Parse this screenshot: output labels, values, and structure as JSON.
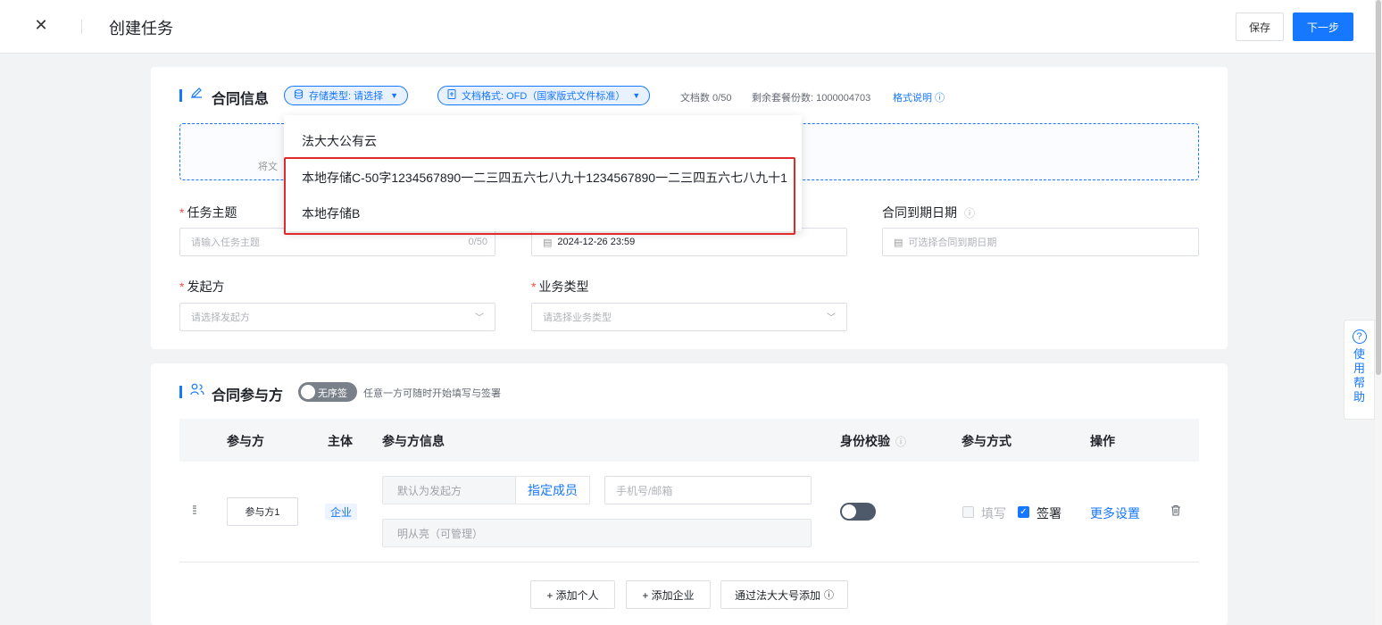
{
  "header": {
    "close": "✕",
    "title": "创建任务",
    "save_label": "保存",
    "next_label": "下一步"
  },
  "contract_info": {
    "title": "合同信息",
    "storage_type_label": "存储类型: 请选择",
    "doc_format_label": "文档格式: OFD（国家版式文件标准）",
    "doc_count": "文档数 0/50",
    "remaining": "剩余套餐份数: 1000004703",
    "format_help": "格式说明",
    "upload_hint": "将文",
    "storage_options": [
      "法大大公有云",
      "本地存储C-50字1234567890一二三四五六七八九十1234567890一二三四五六七八九十1",
      "本地存储B"
    ],
    "task_subject": {
      "label": "任务主题",
      "placeholder": "请输入任务主题",
      "counter": "0/50"
    },
    "deadline": {
      "value": "2024-12-26 23:59"
    },
    "expiry": {
      "label": "合同到期日期",
      "placeholder": "可选择合同到期日期"
    },
    "initiator": {
      "label": "发起方",
      "placeholder": "请选择发起方"
    },
    "business_type": {
      "label": "业务类型",
      "placeholder": "请选择业务类型"
    }
  },
  "participants": {
    "title": "合同参与方",
    "order_toggle": "无序签",
    "order_hint": "任意一方可随时开始填写与签署",
    "columns": [
      "参与方",
      "主体",
      "参与方信息",
      "身份校验",
      "参与方式",
      "操作"
    ],
    "rows": [
      {
        "party": "参与方1",
        "entity": "企业",
        "default_initiator": "默认为发起方",
        "assign_member": "指定成员",
        "contact_placeholder": "手机号/邮箱",
        "member": "明从亮（可管理）",
        "fill_label": "填写",
        "sign_label": "签署",
        "more_settings": "更多设置"
      }
    ],
    "add_person": "+ 添加个人",
    "add_company": "+ 添加企业",
    "add_via_fadada": "通过法大大号添加"
  },
  "help": {
    "chars": [
      "使",
      "用",
      "帮",
      "助"
    ]
  }
}
